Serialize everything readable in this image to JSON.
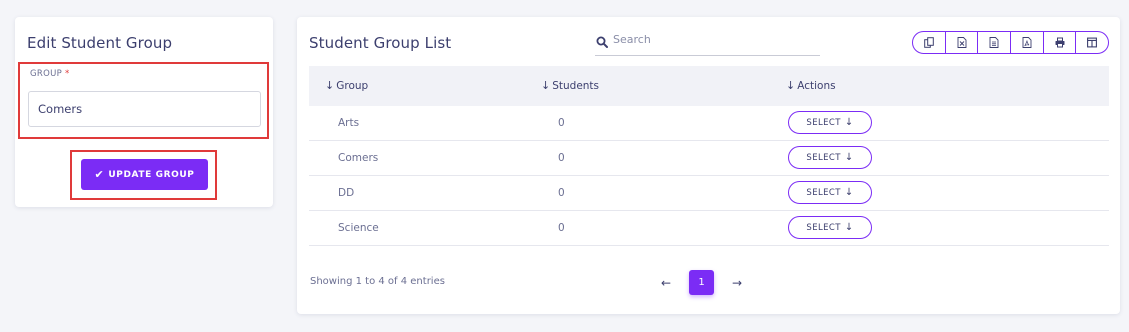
{
  "colors": {
    "accent": "#7b2cf5",
    "highlight_border": "#e03a3a",
    "text": "#3c3f6e",
    "muted_text": "#6b6f92",
    "background": "#f4f5f9"
  },
  "edit_card": {
    "title": "Edit Student Group",
    "field_label": "GROUP",
    "required_mark": "*",
    "field_value": "Comers",
    "button_icon": "check-icon",
    "button_label": "UPDATE GROUP"
  },
  "list_card": {
    "title": "Student Group List",
    "search": {
      "icon": "search-icon",
      "placeholder": "Search",
      "value": ""
    },
    "export_buttons": [
      {
        "icon": "copy-icon"
      },
      {
        "icon": "excel-icon"
      },
      {
        "icon": "csv-icon"
      },
      {
        "icon": "pdf-icon"
      },
      {
        "icon": "print-icon"
      },
      {
        "icon": "columns-icon"
      }
    ],
    "columns": [
      "Group",
      "Students",
      "Actions"
    ],
    "rows": [
      {
        "group": "Arts",
        "students": "0",
        "action": "SELECT"
      },
      {
        "group": "Comers",
        "students": "0",
        "action": "SELECT"
      },
      {
        "group": "DD",
        "students": "0",
        "action": "SELECT"
      },
      {
        "group": "Science",
        "students": "0",
        "action": "SELECT"
      }
    ],
    "entries_info": "Showing 1 to 4 of 4 entries",
    "pagination": {
      "prev": "←",
      "current_page": "1",
      "next": "→"
    },
    "sort_arrow": "↓",
    "action_arrow": "↓"
  }
}
